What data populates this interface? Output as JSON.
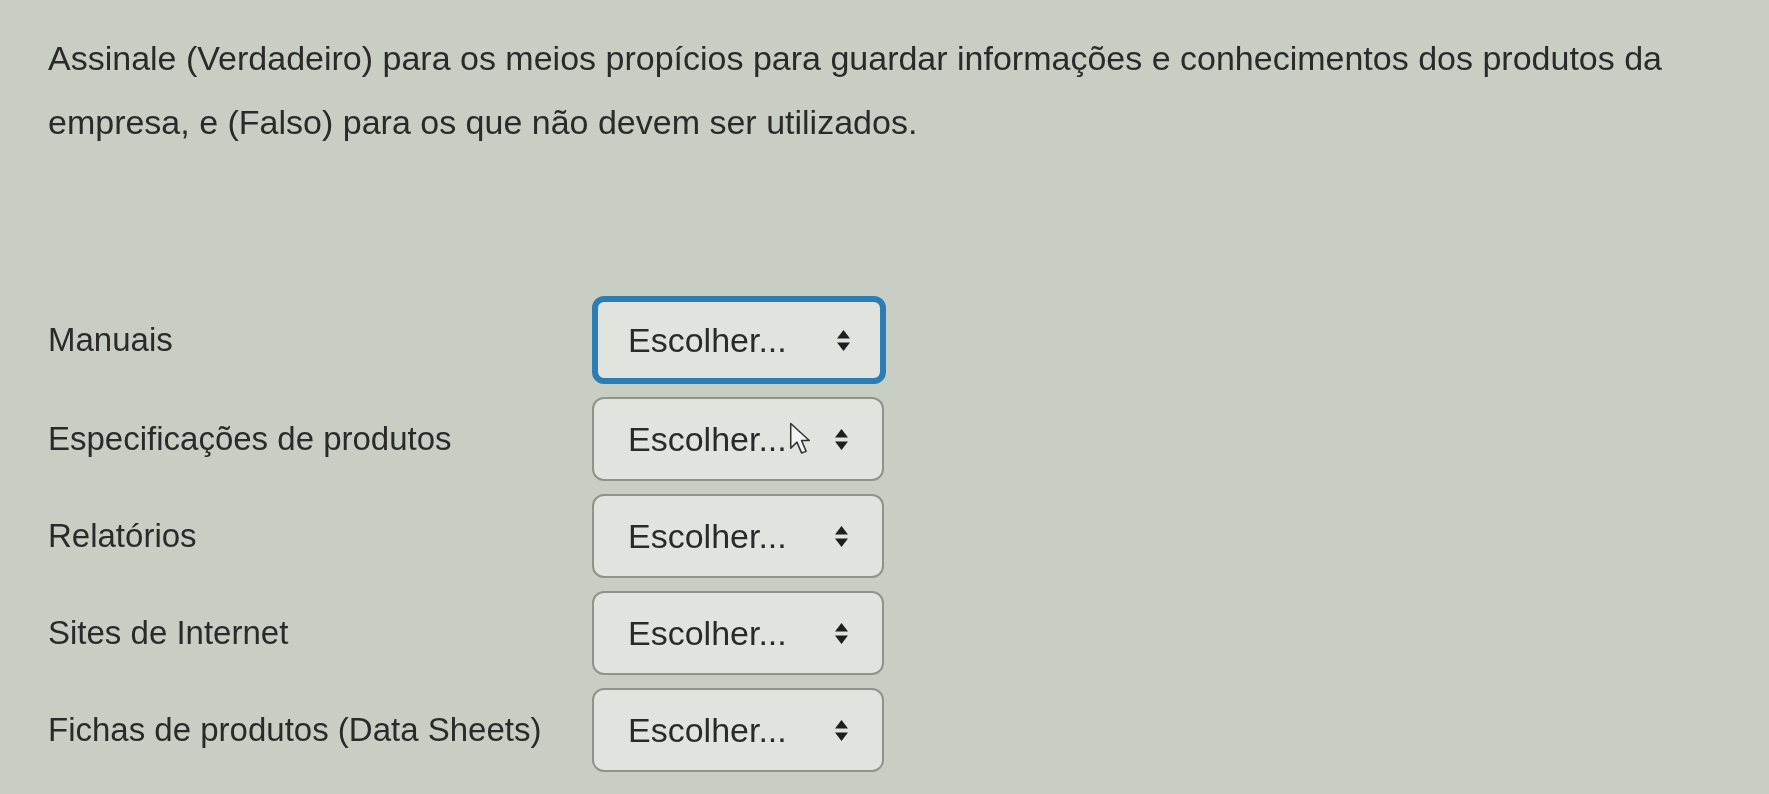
{
  "question": "Assinale (Verdadeiro) para os meios propícios para guardar informações e conhecimentos dos produtos da empresa, e (Falso) para os que não devem ser utilizados.",
  "items": [
    {
      "label": "Manuais",
      "select": {
        "value": "Escolher...",
        "focused": true,
        "hovered": false
      }
    },
    {
      "label": "Especificações de produtos",
      "select": {
        "value": "Escolher...",
        "focused": false,
        "hovered": true
      }
    },
    {
      "label": "Relatórios",
      "select": {
        "value": "Escolher...",
        "focused": false,
        "hovered": false
      }
    },
    {
      "label": "Sites de Internet",
      "select": {
        "value": "Escolher...",
        "focused": false,
        "hovered": false
      }
    },
    {
      "label": "Fichas de produtos (Data Sheets)",
      "select": {
        "value": "Escolher...",
        "focused": false,
        "hovered": false
      }
    }
  ]
}
